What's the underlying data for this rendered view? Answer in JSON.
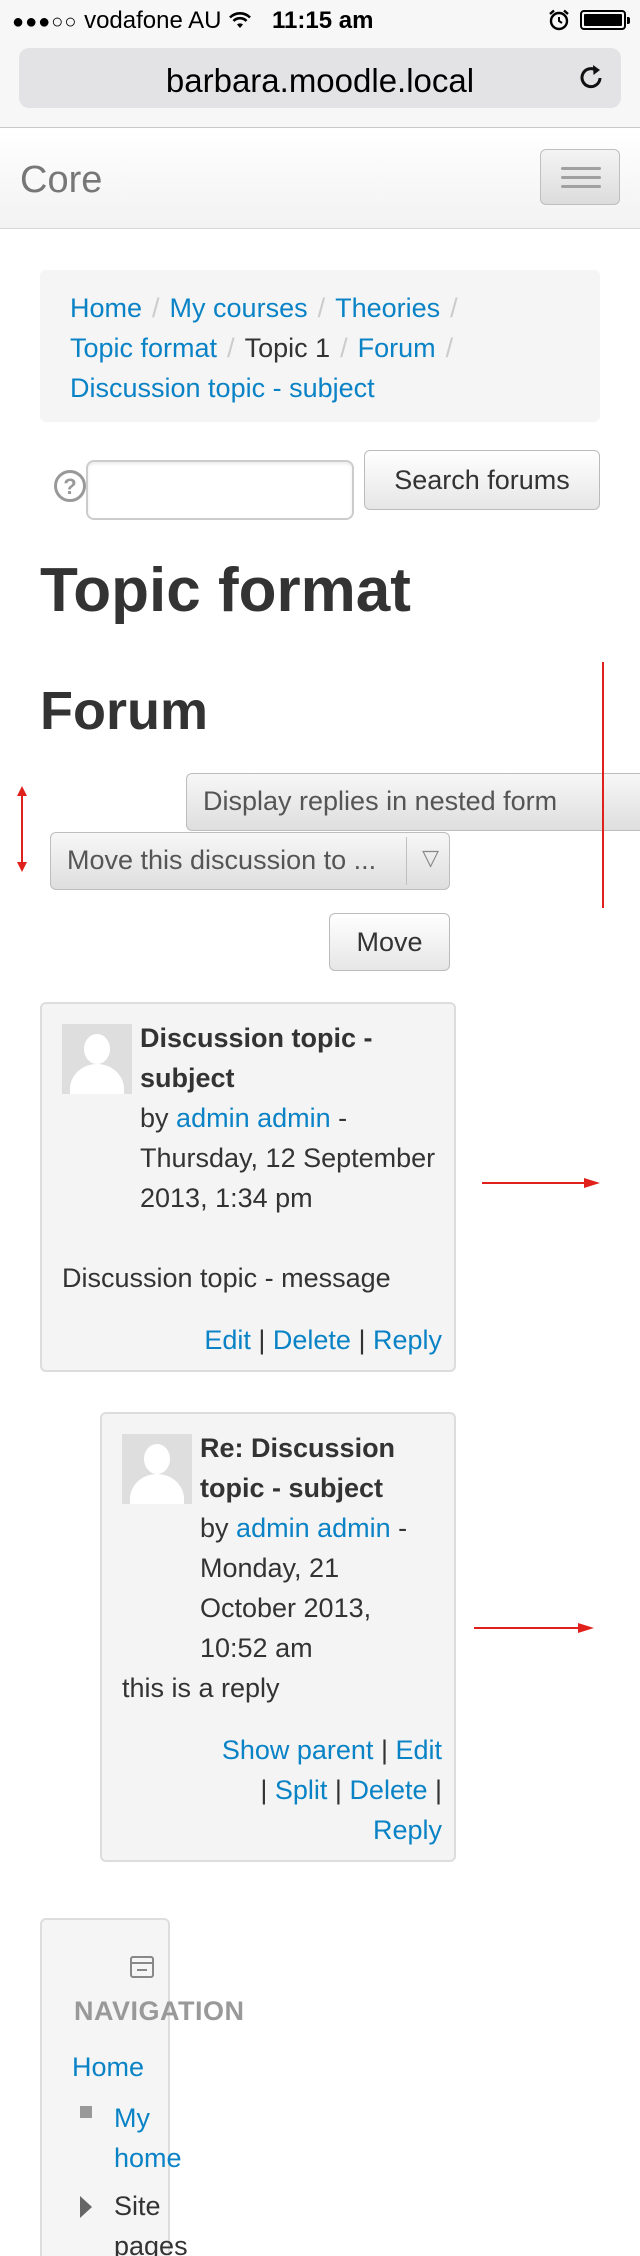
{
  "status_bar": {
    "signal_dots": "●●●○○",
    "carrier": "vodafone AU",
    "time": "11:15 am"
  },
  "browser": {
    "url": "barbara.moodle.local"
  },
  "navbar": {
    "brand": "Core"
  },
  "breadcrumb": {
    "items": [
      "Home",
      "My courses",
      "Theories",
      "Topic format",
      "Topic 1",
      "Forum",
      "Discussion topic - subject"
    ],
    "separator": "/"
  },
  "search": {
    "help": "?",
    "value": "",
    "button_label": "Search forums"
  },
  "page": {
    "heading": "Topic format",
    "subheading": "Forum"
  },
  "controls": {
    "display_mode": "Display replies in nested form",
    "move_select": "Move this discussion to ...",
    "move_button": "Move"
  },
  "posts": [
    {
      "subject": "Discussion topic - subject",
      "by": "by",
      "author": "admin admin",
      "date_sep": "-",
      "date": "Thursday, 12 September 2013, 1:34 pm",
      "message": "Discussion topic - message",
      "links": [
        "Edit",
        "Delete",
        "Reply"
      ]
    },
    {
      "subject": "Re: Discussion topic - subject",
      "by": "by",
      "author": "admin admin",
      "date_sep": "-",
      "date": "Monday, 21 October 2013, 10:52 am",
      "message": "this is a reply",
      "links": [
        "Show parent",
        "Edit",
        "Split",
        "Delete",
        "Reply"
      ]
    }
  ],
  "navigation": {
    "title": "NAVIGATION",
    "home": "Home",
    "items": [
      "My home",
      "Site pages"
    ]
  },
  "colors": {
    "link": "#0a83c6",
    "annotation": "#e0201b"
  }
}
